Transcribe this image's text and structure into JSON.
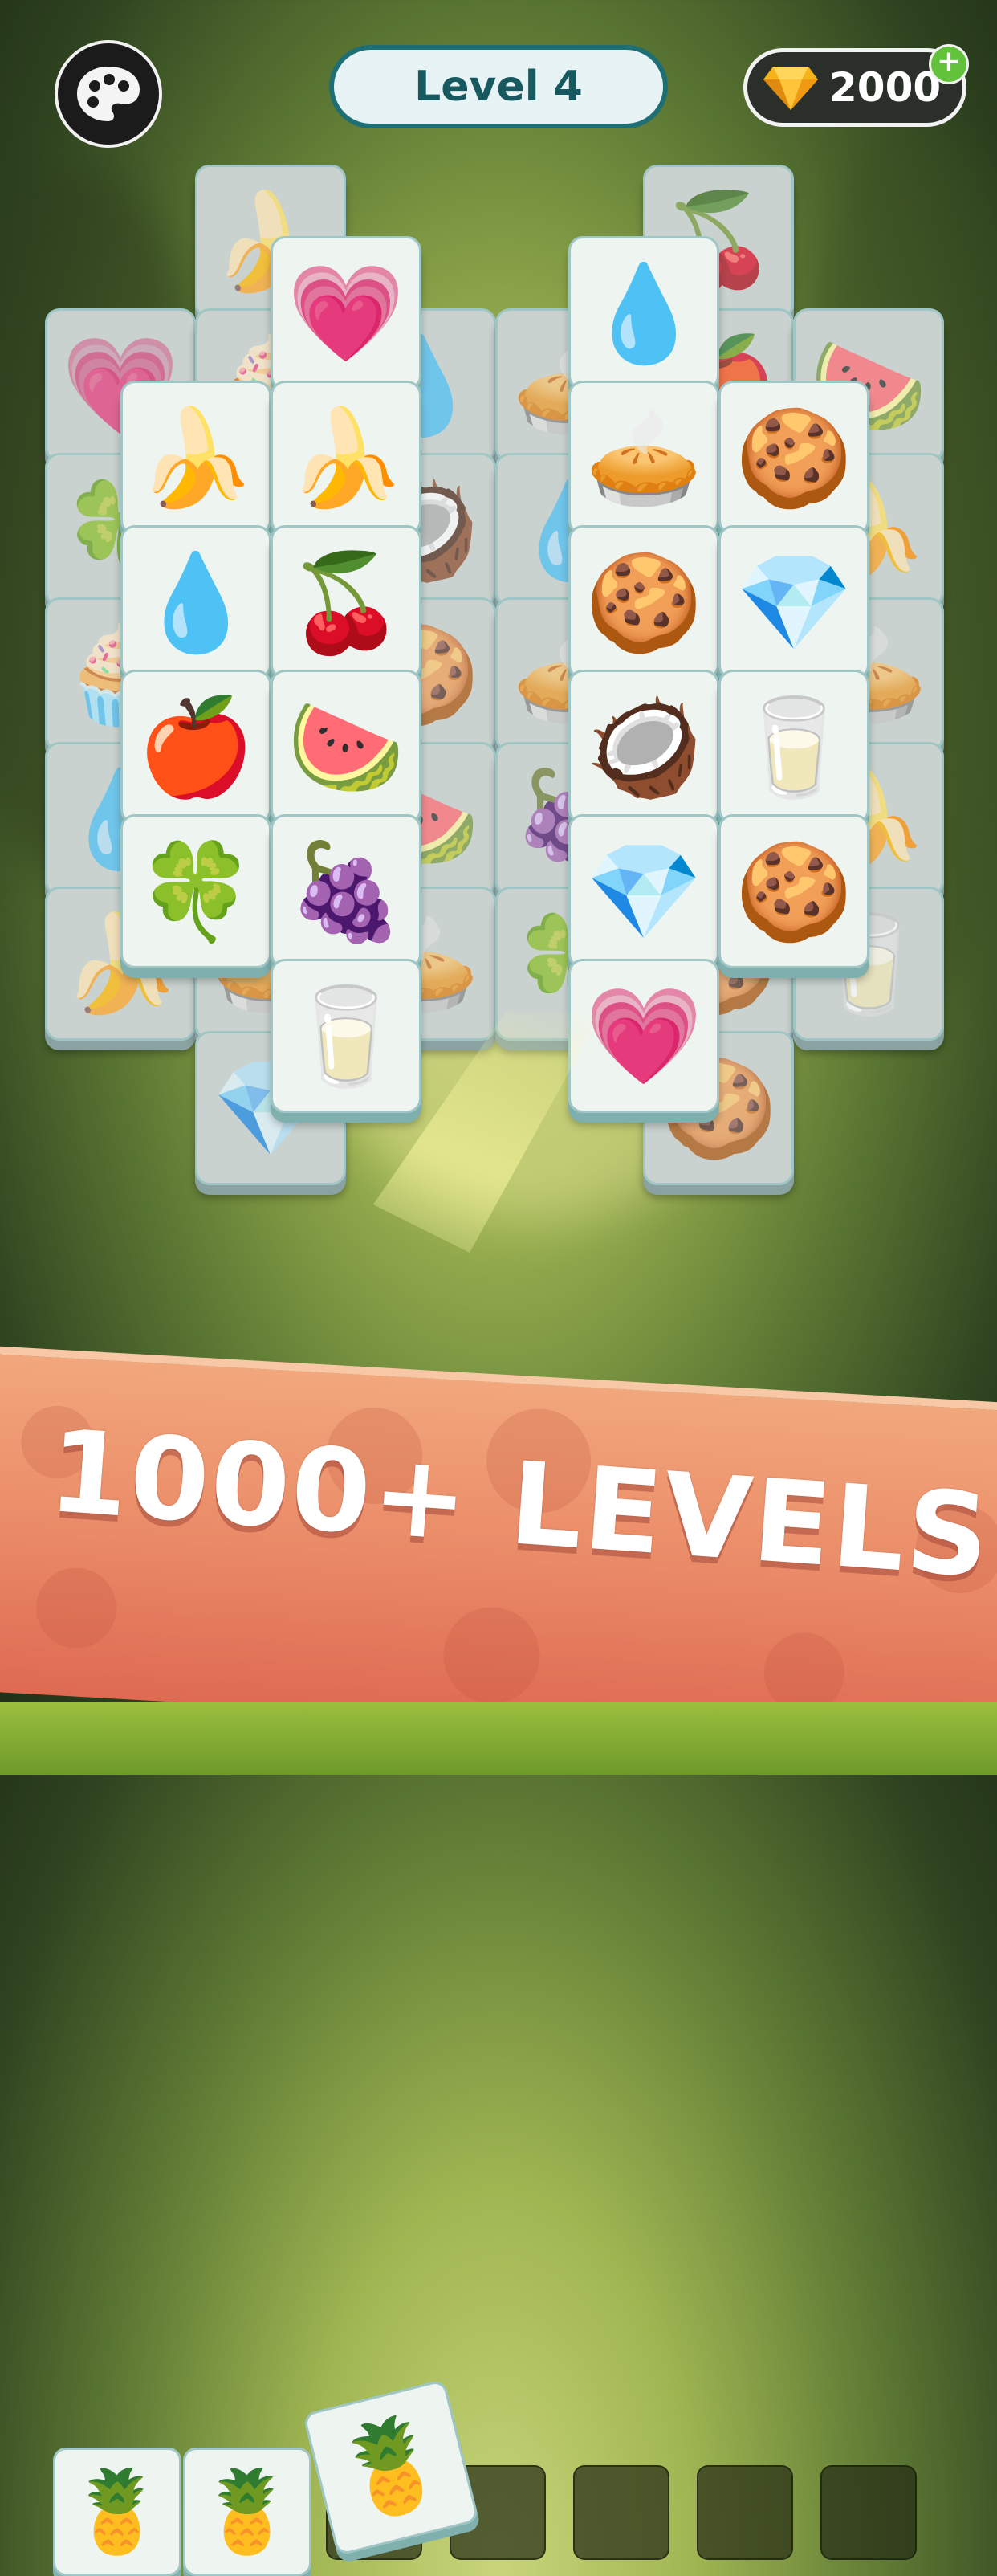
{
  "header": {
    "level_label": "Level 4",
    "gem_count": "2000",
    "palette_icon": "palette-icon",
    "gem_icon": "gem-icon",
    "plus_icon": "plus-icon"
  },
  "board": {
    "icons": {
      "banana": "🍌",
      "heart": "💗",
      "cherry": "🍒",
      "drop": "💧",
      "cookie": "🍪",
      "pie": "🥧",
      "clover": "🍀",
      "muffin": "🧁",
      "coconut": "🥥",
      "watermelon": "🍉",
      "apple": "🍎",
      "grape": "🍇",
      "diamond": "💎",
      "milk": "🥛",
      "pineapple": "🍍"
    }
  },
  "tray": {
    "slot_count": 7,
    "filled": [
      "pineapple",
      "pineapple"
    ],
    "incoming": "pineapple"
  },
  "banner": {
    "text": "1000+ LEVELS"
  },
  "colors": {
    "level_border": "#1e6f73",
    "banner": "#ea8b68",
    "plus_badge": "#62c33a"
  }
}
